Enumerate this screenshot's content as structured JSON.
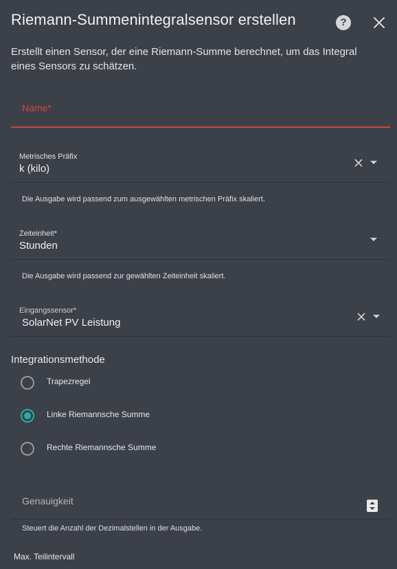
{
  "dialog": {
    "title": "Riemann-Summenintegralsensor erstellen",
    "description": "Erstellt einen Sensor, der eine Riemann-Summe berechnet, um das Integral eines Sensors zu schätzen."
  },
  "name_field": {
    "label": "Name",
    "required_mark": "*",
    "value": ""
  },
  "metric_prefix": {
    "label": "Metrisches Präfix",
    "value": "k (kilo)",
    "helper": "Die Ausgabe wird passend zum ausgewählten metrischen Präfix skaliert."
  },
  "time_unit": {
    "label": "Zeiteinheit",
    "required_mark": "*",
    "value": "Stunden",
    "helper": "Die Ausgabe wird passend zur gewählten Zeiteinheit skaliert."
  },
  "input_sensor": {
    "label": "Eingangssensor",
    "required_mark": "*",
    "value": "SolarNet PV Leistung"
  },
  "integration_method": {
    "title": "Integrationsmethode",
    "options": [
      {
        "label": "Trapezregel",
        "checked": false
      },
      {
        "label": "Linke Riemannsche Summe",
        "checked": true
      },
      {
        "label": "Rechte Riemannsche Summe",
        "checked": false
      }
    ]
  },
  "precision": {
    "placeholder": "Genauigkeit",
    "helper": "Steuert die Anzahl der Dezimalstellen in der Ausgabe."
  },
  "max_sub_interval": {
    "label": "Max. Teilintervall"
  },
  "colors": {
    "background": "#3c4049",
    "error": "#d3463f",
    "accent": "#1fb3a5"
  },
  "icons": {
    "help": "help-circle-icon",
    "close": "close-icon",
    "clear": "clear-icon",
    "dropdown": "chevron-down-icon"
  }
}
